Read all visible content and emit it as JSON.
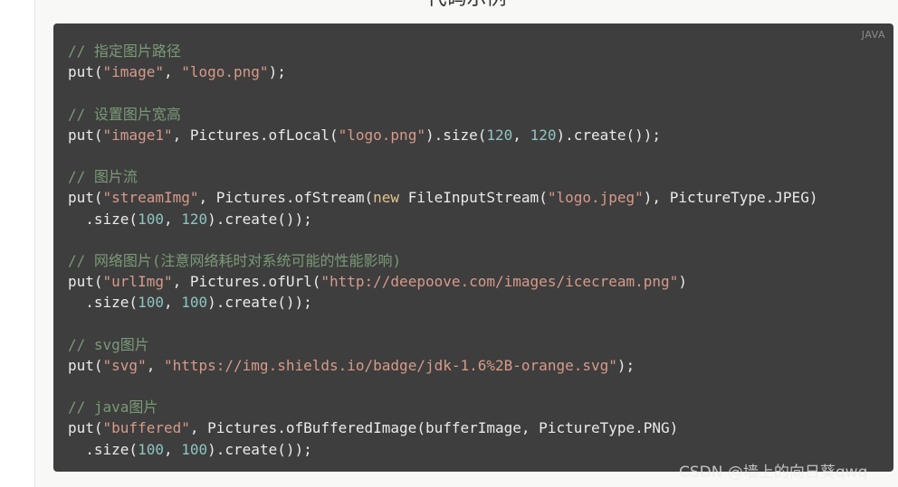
{
  "page": {
    "heading": "代码示例",
    "language_label": "JAVA",
    "watermark": "CSDN @墙上的向日葵qwq"
  },
  "colors": {
    "code_background": "#3e3e3e",
    "comment": "#7a9a76",
    "string": "#d69a8a",
    "number": "#8fc4c2",
    "keyword": "#e0c38f",
    "plain": "#eaeaea"
  },
  "code_lines": [
    [
      {
        "t": "comment",
        "v": "// 指定图片路径"
      }
    ],
    [
      {
        "t": "plain",
        "v": "put("
      },
      {
        "t": "string",
        "v": "\"image\""
      },
      {
        "t": "plain",
        "v": ", "
      },
      {
        "t": "string",
        "v": "\"logo.png\""
      },
      {
        "t": "plain",
        "v": ");"
      }
    ],
    [],
    [
      {
        "t": "comment",
        "v": "// 设置图片宽高"
      }
    ],
    [
      {
        "t": "plain",
        "v": "put("
      },
      {
        "t": "string",
        "v": "\"image1\""
      },
      {
        "t": "plain",
        "v": ", Pictures.ofLocal("
      },
      {
        "t": "string",
        "v": "\"logo.png\""
      },
      {
        "t": "plain",
        "v": ").size("
      },
      {
        "t": "number",
        "v": "120"
      },
      {
        "t": "plain",
        "v": ", "
      },
      {
        "t": "number",
        "v": "120"
      },
      {
        "t": "plain",
        "v": ").create());"
      }
    ],
    [],
    [
      {
        "t": "comment",
        "v": "// 图片流"
      }
    ],
    [
      {
        "t": "plain",
        "v": "put("
      },
      {
        "t": "string",
        "v": "\"streamImg\""
      },
      {
        "t": "plain",
        "v": ", Pictures.ofStream("
      },
      {
        "t": "keyword",
        "v": "new"
      },
      {
        "t": "plain",
        "v": " FileInputStream("
      },
      {
        "t": "string",
        "v": "\"logo.jpeg\""
      },
      {
        "t": "plain",
        "v": "), PictureType.JPEG)"
      }
    ],
    [
      {
        "t": "plain",
        "v": "  .size("
      },
      {
        "t": "number",
        "v": "100"
      },
      {
        "t": "plain",
        "v": ", "
      },
      {
        "t": "number",
        "v": "120"
      },
      {
        "t": "plain",
        "v": ").create());"
      }
    ],
    [],
    [
      {
        "t": "comment",
        "v": "// 网络图片(注意网络耗时对系统可能的性能影响)"
      }
    ],
    [
      {
        "t": "plain",
        "v": "put("
      },
      {
        "t": "string",
        "v": "\"urlImg\""
      },
      {
        "t": "plain",
        "v": ", Pictures.ofUrl("
      },
      {
        "t": "string",
        "v": "\"http://deepoove.com/images/icecream.png\""
      },
      {
        "t": "plain",
        "v": ")"
      }
    ],
    [
      {
        "t": "plain",
        "v": "  .size("
      },
      {
        "t": "number",
        "v": "100"
      },
      {
        "t": "plain",
        "v": ", "
      },
      {
        "t": "number",
        "v": "100"
      },
      {
        "t": "plain",
        "v": ").create());"
      }
    ],
    [],
    [
      {
        "t": "comment",
        "v": "// svg图片"
      }
    ],
    [
      {
        "t": "plain",
        "v": "put("
      },
      {
        "t": "string",
        "v": "\"svg\""
      },
      {
        "t": "plain",
        "v": ", "
      },
      {
        "t": "string",
        "v": "\"https://img.shields.io/badge/jdk-1.6%2B-orange.svg\""
      },
      {
        "t": "plain",
        "v": ");"
      }
    ],
    [],
    [
      {
        "t": "comment",
        "v": "// java图片"
      }
    ],
    [
      {
        "t": "plain",
        "v": "put("
      },
      {
        "t": "string",
        "v": "\"buffered\""
      },
      {
        "t": "plain",
        "v": ", Pictures.ofBufferedImage(bufferImage, PictureType.PNG)"
      }
    ],
    [
      {
        "t": "plain",
        "v": "  .size("
      },
      {
        "t": "number",
        "v": "100"
      },
      {
        "t": "plain",
        "v": ", "
      },
      {
        "t": "number",
        "v": "100"
      },
      {
        "t": "plain",
        "v": ").create());"
      }
    ]
  ]
}
